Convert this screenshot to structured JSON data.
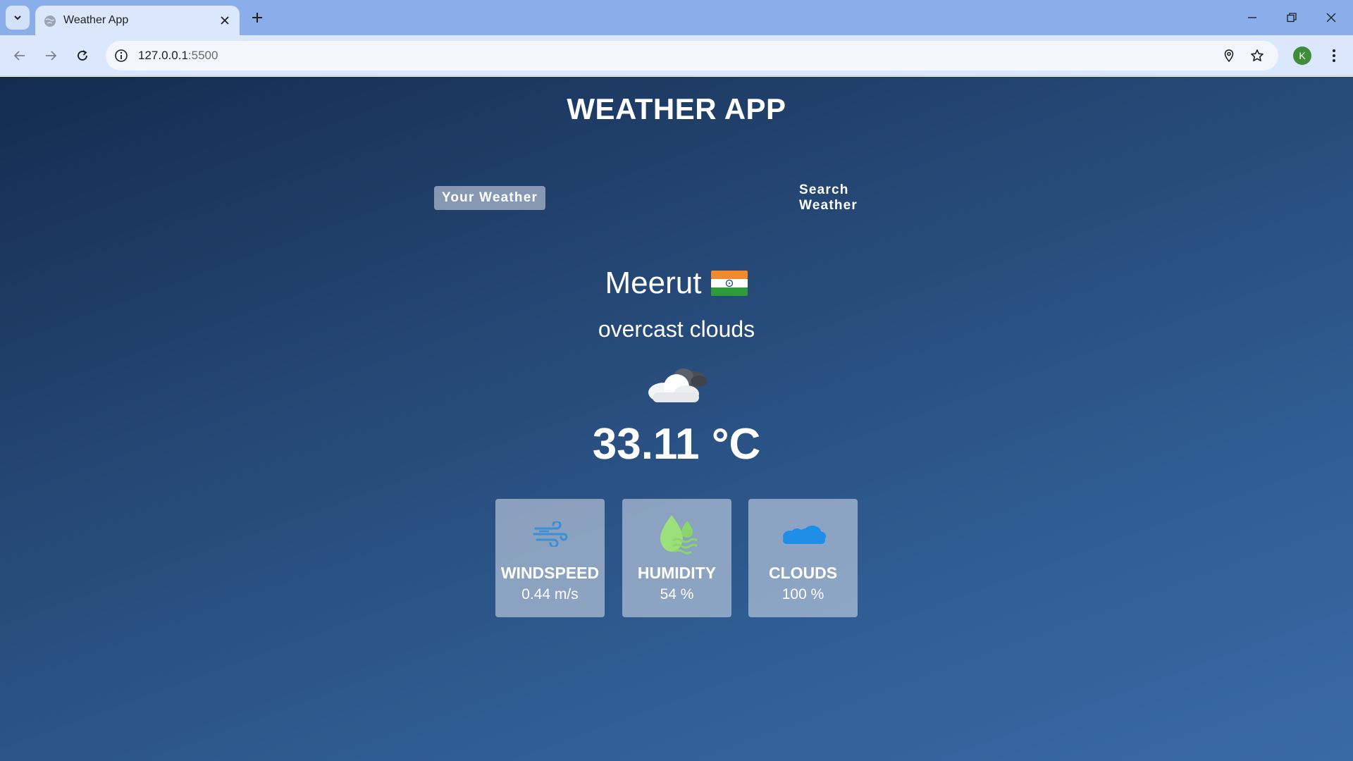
{
  "browser": {
    "tab_title": "Weather App",
    "url_host": "127.0.0.1",
    "url_port": ":5500",
    "profile_initial": "K",
    "accent_color": "#8aaeea"
  },
  "app": {
    "title": "WEATHER APP",
    "tabs": [
      {
        "label": "Your Weather",
        "active": true
      },
      {
        "label": "Search Weather",
        "active": false
      }
    ],
    "city": "Meerut",
    "country_flag": "india-flag-icon",
    "description": "overcast clouds",
    "weather_icon": "overcast-clouds-icon",
    "temperature": "33.11 °C",
    "stats": [
      {
        "icon": "wind-icon",
        "label": "WINDSPEED",
        "value": "0.44 m/s"
      },
      {
        "icon": "humidity-icon",
        "label": "HUMIDITY",
        "value": "54 %"
      },
      {
        "icon": "clouds-icon",
        "label": "CLOUDS",
        "value": "100 %"
      }
    ]
  }
}
